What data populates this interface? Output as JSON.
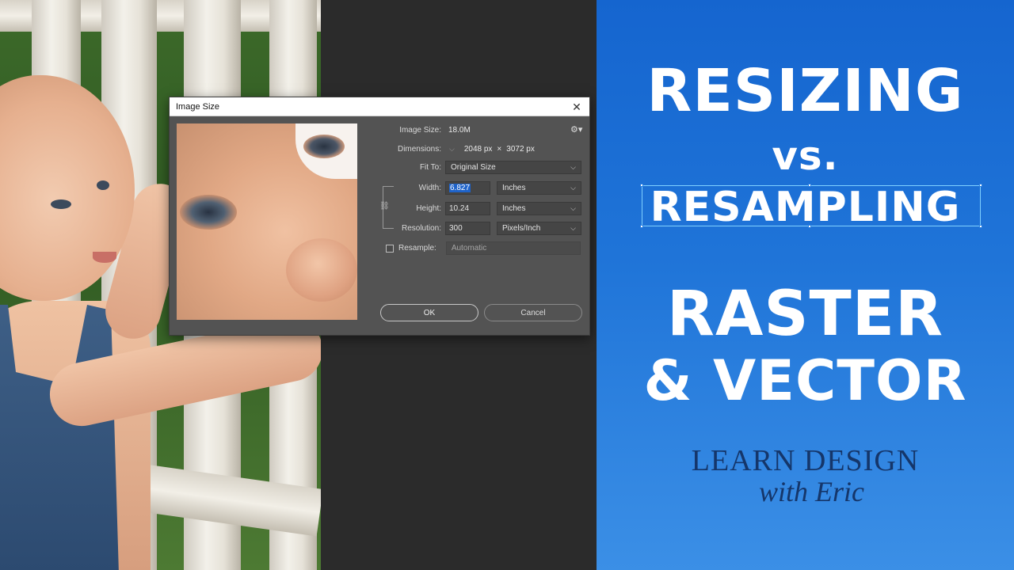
{
  "dialog": {
    "title": "Image Size",
    "image_size_label": "Image Size:",
    "image_size_value": "18.0M",
    "dimensions_label": "Dimensions:",
    "dimensions_w": "2048 px",
    "dimensions_x": "×",
    "dimensions_h": "3072 px",
    "fit_to_label": "Fit To:",
    "fit_to_value": "Original Size",
    "width_label": "Width:",
    "width_value": "6.827",
    "width_unit": "Inches",
    "height_label": "Height:",
    "height_value": "10.24",
    "height_unit": "Inches",
    "resolution_label": "Resolution:",
    "resolution_value": "300",
    "resolution_unit": "Pixels/Inch",
    "resample_label": "Resample:",
    "resample_value": "Automatic",
    "resample_checked": false,
    "ok_label": "OK",
    "cancel_label": "Cancel"
  },
  "banner": {
    "line1": "RESIZING",
    "line2": "vs.",
    "line3": "RESAMPLING",
    "line4": "RASTER",
    "line5": "& VECTOR",
    "logo_line1": "LEARN DESIGN",
    "logo_line2": "with Eric"
  },
  "colors": {
    "banner_blue": "#1565cf",
    "dialog_bg": "#535353",
    "selection_blue": "#1f63c9",
    "logo_navy": "#15366a"
  }
}
